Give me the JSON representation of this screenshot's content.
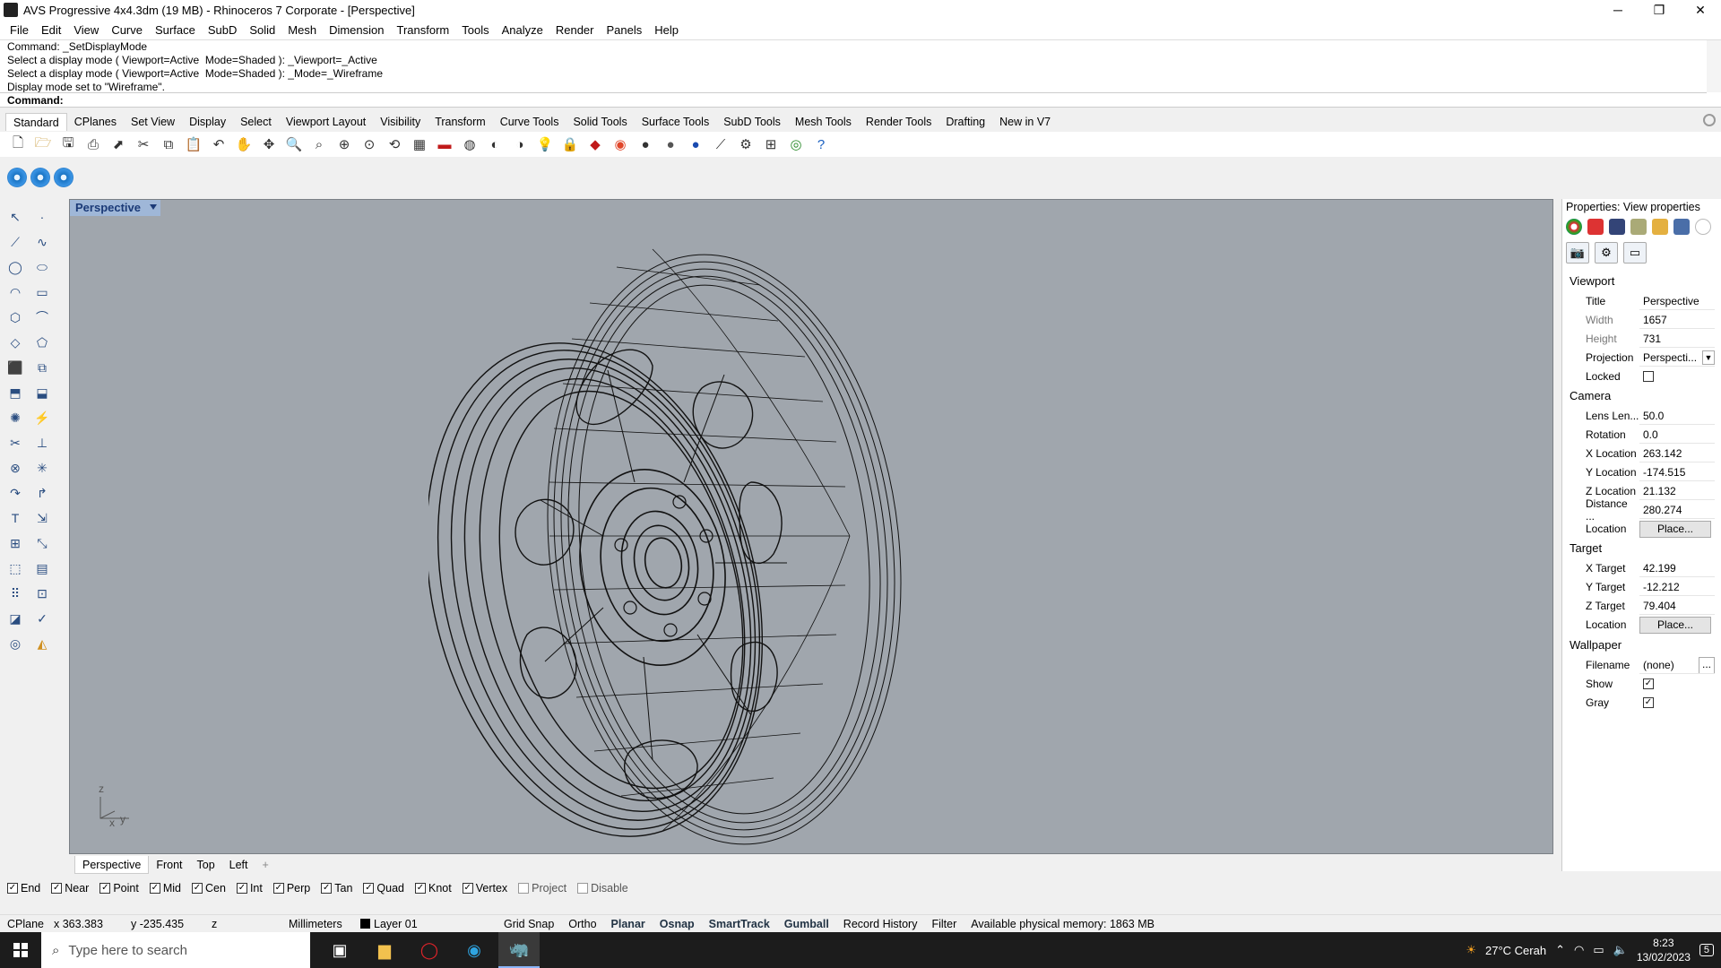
{
  "window": {
    "title": "AVS Progressive 4x4.3dm (19 MB) - Rhinoceros 7 Corporate - [Perspective]",
    "minimize": "─",
    "restore": "❐",
    "close": "✕"
  },
  "menubar": [
    "File",
    "Edit",
    "View",
    "Curve",
    "Surface",
    "SubD",
    "Solid",
    "Mesh",
    "Dimension",
    "Transform",
    "Tools",
    "Analyze",
    "Render",
    "Panels",
    "Help"
  ],
  "command_history": [
    "Command: _SetDisplayMode",
    "Select a display mode ( Viewport=Active  Mode=Shaded ): _Viewport=_Active",
    "Select a display mode ( Viewport=Active  Mode=Shaded ): _Mode=_Wireframe",
    "Display mode set to \"Wireframe\"."
  ],
  "command_prompt": "Command:",
  "toolbar_tabs": [
    "Standard",
    "CPlanes",
    "Set View",
    "Display",
    "Select",
    "Viewport Layout",
    "Visibility",
    "Transform",
    "Curve Tools",
    "Solid Tools",
    "Surface Tools",
    "SubD Tools",
    "Mesh Tools",
    "Render Tools",
    "Drafting",
    "New in V7"
  ],
  "viewport": {
    "label": "Perspective",
    "axis_z": "z",
    "axis_x": "x",
    "axis_y": "y"
  },
  "viewport_tabs": [
    "Perspective",
    "Front",
    "Top",
    "Left",
    "+"
  ],
  "osnaps": [
    {
      "label": "End",
      "checked": true
    },
    {
      "label": "Near",
      "checked": true
    },
    {
      "label": "Point",
      "checked": true
    },
    {
      "label": "Mid",
      "checked": true
    },
    {
      "label": "Cen",
      "checked": true
    },
    {
      "label": "Int",
      "checked": true
    },
    {
      "label": "Perp",
      "checked": true
    },
    {
      "label": "Tan",
      "checked": true
    },
    {
      "label": "Quad",
      "checked": true
    },
    {
      "label": "Knot",
      "checked": true
    },
    {
      "label": "Vertex",
      "checked": true
    },
    {
      "label": "Project",
      "checked": false
    },
    {
      "label": "Disable",
      "checked": false
    }
  ],
  "statusbar": {
    "cplane": "CPlane",
    "x": "x 363.383",
    "y": "y -235.435",
    "z": "z",
    "units": "Millimeters",
    "layer": "Layer 01",
    "grid_snap": "Grid Snap",
    "ortho": "Ortho",
    "planar": "Planar",
    "osnap": "Osnap",
    "smarttrack": "SmartTrack",
    "gumball": "Gumball",
    "record_history": "Record History",
    "filter": "Filter",
    "memory": "Available physical memory: 1863 MB"
  },
  "properties": {
    "title": "Properties: View properties",
    "sections": {
      "viewport": "Viewport",
      "camera": "Camera",
      "target": "Target",
      "wallpaper": "Wallpaper"
    },
    "viewport_rows": [
      {
        "label": "Title",
        "value": "Perspective"
      },
      {
        "label": "Width",
        "value": "1657"
      },
      {
        "label": "Height",
        "value": "731"
      },
      {
        "label": "Projection",
        "value": "Perspecti..."
      },
      {
        "label": "Locked",
        "value": ""
      }
    ],
    "camera_rows": [
      {
        "label": "Lens Len...",
        "value": "50.0"
      },
      {
        "label": "Rotation",
        "value": "0.0"
      },
      {
        "label": "X Location",
        "value": "263.142"
      },
      {
        "label": "Y Location",
        "value": "-174.515"
      },
      {
        "label": "Z Location",
        "value": "21.132"
      },
      {
        "label": "Distance ...",
        "value": "280.274"
      },
      {
        "label": "Location",
        "value": "Place..."
      }
    ],
    "target_rows": [
      {
        "label": "X Target",
        "value": "42.199"
      },
      {
        "label": "Y Target",
        "value": "-12.212"
      },
      {
        "label": "Z Target",
        "value": "79.404"
      },
      {
        "label": "Location",
        "value": "Place..."
      }
    ],
    "wallpaper_rows": [
      {
        "label": "Filename",
        "value": "(none)"
      },
      {
        "label": "Show",
        "value": "✓"
      },
      {
        "label": "Gray",
        "value": "✓"
      }
    ],
    "dots": "..."
  },
  "taskbar": {
    "search_placeholder": "Type here to search",
    "weather": "27°C  Cerah",
    "time": "8:23",
    "date": "13/02/2023",
    "notifications": "5"
  },
  "colors": {
    "viewport_bg": "#a0a6ad",
    "viewport_label_bg": "#9fb7d8",
    "wire": "#111111"
  }
}
